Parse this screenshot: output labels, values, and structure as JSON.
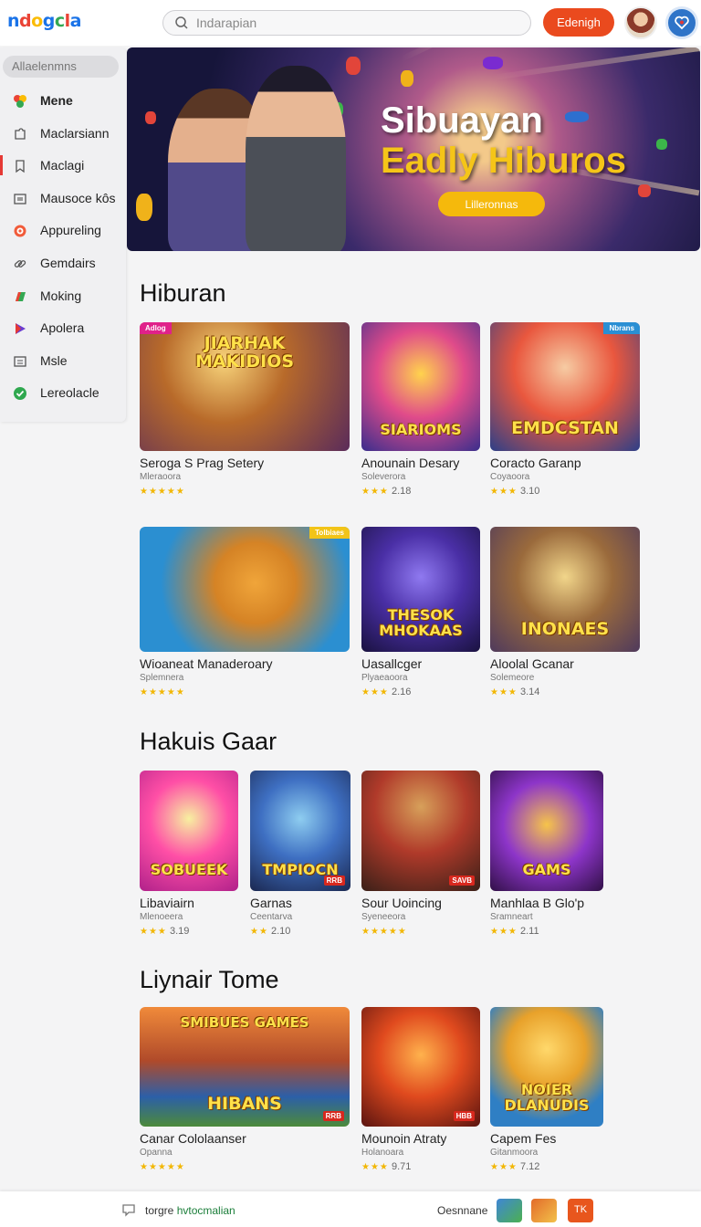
{
  "header": {
    "logo": "ndogcla",
    "logo_colors": [
      "#1a73e8",
      "#ea4335",
      "#fbbc05",
      "#1a73e8",
      "#34a853",
      "#ea4335",
      "#1a73e8"
    ],
    "search_placeholder": "Indarapian",
    "signin_label": "Edenigh",
    "accent": "#ea4a1e"
  },
  "sidebar": {
    "search_label": "Allaelenmns",
    "items": [
      {
        "label": "Mene",
        "icon": "home-icon",
        "active": true
      },
      {
        "label": "Maclarsiann",
        "icon": "puzzle-icon"
      },
      {
        "label": "Maclagi",
        "icon": "bookmark-icon"
      },
      {
        "label": "Mausoce kôs",
        "icon": "window-icon"
      },
      {
        "label": "Appureling",
        "icon": "target-icon"
      },
      {
        "label": "Gemdairs",
        "icon": "link-icon"
      },
      {
        "label": "Moking",
        "icon": "flag-icon"
      },
      {
        "label": "Apolera",
        "icon": "play-icon"
      },
      {
        "label": "Msle",
        "icon": "list-icon"
      },
      {
        "label": "Lereolacle",
        "icon": "check-icon"
      }
    ]
  },
  "hero": {
    "title_line1": "Sibuayan",
    "title_line2": "Eadly Hiburos",
    "button_label": "Lilleronnas"
  },
  "sections": [
    {
      "title": "Hiburan",
      "cards": [
        {
          "name": "Seroga S Prag Setery",
          "dev": "Mleraoora",
          "rating": "",
          "stars": "★★★★★",
          "caption": "JIARHAK\nMAKIDIOS",
          "ribbon": "Adlog"
        },
        {
          "name": "Anounain Desary",
          "dev": "Soleverora",
          "rating": "2.18",
          "stars": "★★★",
          "caption": "SIARIOMS"
        },
        {
          "name": "Coracto Garanp",
          "dev": "Coyaoora",
          "rating": "3.10",
          "stars": "★★★",
          "caption": "EMDCSTAN",
          "ribbon": "Nbrans"
        },
        {
          "name": "Wioaneat Manaderoary",
          "dev": "Splemnera",
          "rating": "",
          "stars": "★★★★★",
          "caption": "",
          "ribbon": "Tolbiaes"
        },
        {
          "name": "Uasallcger",
          "dev": "Plyaeaoora",
          "rating": "2.16",
          "stars": "★★★",
          "caption": "THESOK\nMHOKAAS"
        },
        {
          "name": "Aloolal Gcanar",
          "dev": "Solemeore",
          "rating": "3.14",
          "stars": "★★★",
          "caption": "INONAES"
        }
      ]
    },
    {
      "title": "Hakuis Gaar",
      "cards": [
        {
          "name": "Libaviairn",
          "dev": "Mlenoeera",
          "rating": "3.19",
          "stars": "★★★",
          "caption": "SOBUEEK"
        },
        {
          "name": "Garnas",
          "dev": "Ceentarva",
          "rating": "2.10",
          "stars": "★★",
          "caption": "TMPIOCN",
          "sticker": "RRB"
        },
        {
          "name": "Sour Uoincing",
          "dev": "Syeneeora",
          "rating": "",
          "stars": "★★★★★",
          "caption": "",
          "sticker": "SAVB"
        },
        {
          "name": "Manhlaa B Glo'p",
          "dev": "Sramneart",
          "rating": "2.11",
          "stars": "★★★",
          "caption": "GAMS"
        }
      ]
    },
    {
      "title": "Liynair Tome",
      "cards": [
        {
          "name": "Canar Cololaanser",
          "dev": "Opanna",
          "rating": "",
          "stars": "★★★★★",
          "caption": "HIBANS",
          "caption_top": "SMIBUES GAMES",
          "sticker": "RRB"
        },
        {
          "name": "Mounoin Atraty",
          "dev": "Holanoara",
          "rating": "9.71",
          "stars": "★★★",
          "caption": "",
          "sticker": "HBB"
        },
        {
          "name": "Capem Fes",
          "dev": "Gitanmoora",
          "rating": "7.12",
          "stars": "★★★",
          "caption": "NOIER\nDLANUDIS"
        }
      ]
    }
  ],
  "bottombar": {
    "text1_prefix": "torgre",
    "text1_link": "hvtocmalian",
    "text2": "Oesnnane",
    "badge": "TK"
  }
}
